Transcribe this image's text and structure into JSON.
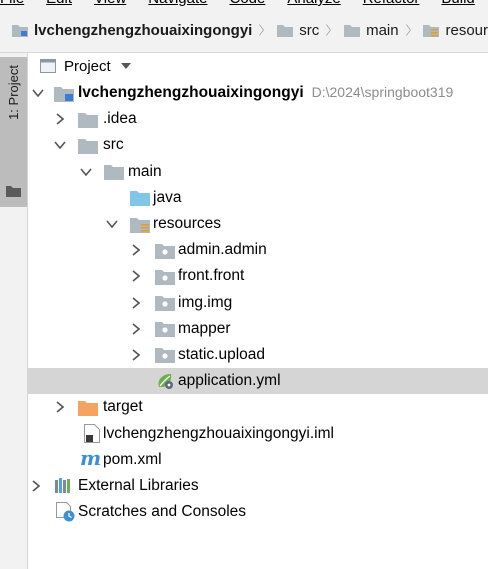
{
  "menu": [
    "File",
    "Edit",
    "View",
    "Navigate",
    "Code",
    "Analyze",
    "Refactor",
    "Build",
    "R"
  ],
  "breadcrumb": [
    {
      "label": "lvchengzhengzhouaixingongyi",
      "bold": true,
      "icon": "module-folder-icon"
    },
    {
      "label": "src",
      "bold": false,
      "icon": "folder-icon"
    },
    {
      "label": "main",
      "bold": false,
      "icon": "folder-icon"
    },
    {
      "label": "resour",
      "bold": false,
      "icon": "resources-folder-icon"
    }
  ],
  "side_tab": {
    "label": "1: Project"
  },
  "project_panel": {
    "title": "Project"
  },
  "tree": {
    "root": {
      "label": "lvchengzhengzhouaixingongyi",
      "path": "D:\\2024\\springboot319"
    },
    "idea": ".idea",
    "src": "src",
    "main": "main",
    "java": "java",
    "resources": "resources",
    "admin": "admin.admin",
    "front": "front.front",
    "img": "img.img",
    "mapper": "mapper",
    "static": "static.upload",
    "application": "application.yml",
    "target": "target",
    "iml": "lvchengzhengzhouaixingongyi.iml",
    "pom": "pom.xml",
    "libraries": "External Libraries",
    "scratches": "Scratches and Consoles"
  },
  "colors": {
    "folder": "#aeb9c0",
    "java_folder": "#7fc6e8",
    "target_folder": "#f4a460",
    "selected_row": "#d5d5d5",
    "maven_blue": "#3d8fd6"
  }
}
